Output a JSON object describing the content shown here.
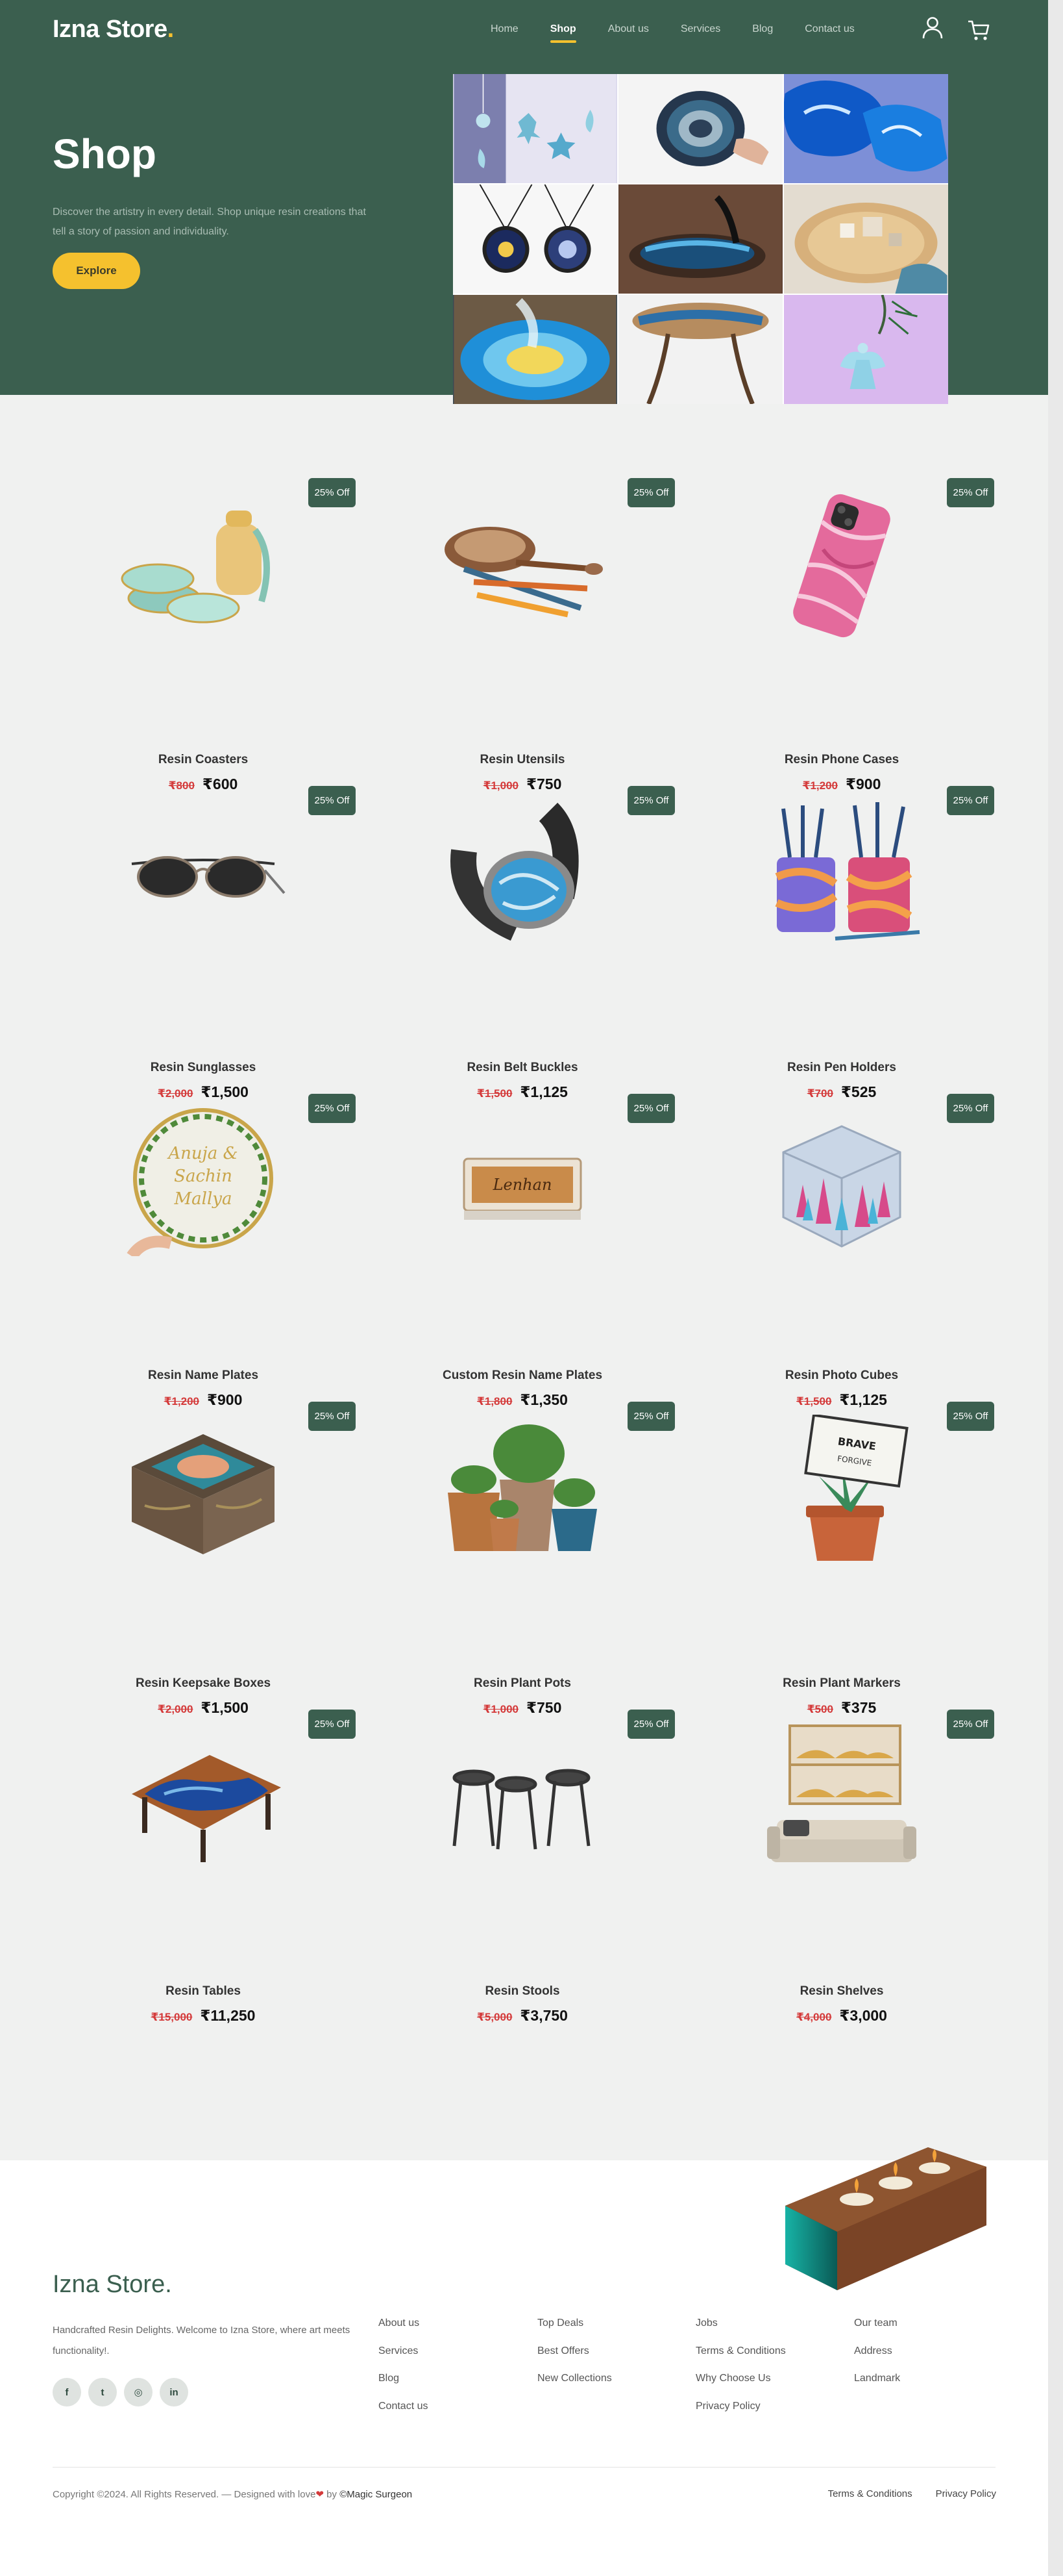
{
  "header": {
    "logo": "Izna Store",
    "logo_dot": ".",
    "nav": [
      {
        "label": "Home",
        "active": false
      },
      {
        "label": "Shop",
        "active": true
      },
      {
        "label": "About us",
        "active": false
      },
      {
        "label": "Services",
        "active": false
      },
      {
        "label": "Blog",
        "active": false
      },
      {
        "label": "Contact us",
        "active": false
      }
    ],
    "icons": [
      "user-icon",
      "cart-icon"
    ]
  },
  "hero": {
    "title": "Shop",
    "description": "Discover the artistry in every detail. Shop unique resin creations that tell a story of passion and individuality.",
    "button": "Explore",
    "tiles": [
      "resin-ornaments",
      "geode-coaster",
      "blue-resin-slices",
      "resin-pendants",
      "river-table-pour",
      "wood-resin-tray",
      "blue-geode-coaster",
      "resin-stool",
      "angel-ornament"
    ]
  },
  "products": [
    {
      "name": "Resin Coasters",
      "old_price": "₹800",
      "price": "₹600",
      "badge": "25% Off"
    },
    {
      "name": "Resin Utensils",
      "old_price": "₹1,000",
      "price": "₹750",
      "badge": "25% Off"
    },
    {
      "name": "Resin Phone Cases",
      "old_price": "₹1,200",
      "price": "₹900",
      "badge": "25% Off"
    },
    {
      "name": "Resin Sunglasses",
      "old_price": "₹2,000",
      "price": "₹1,500",
      "badge": "25% Off"
    },
    {
      "name": "Resin Belt Buckles",
      "old_price": "₹1,500",
      "price": "₹1,125",
      "badge": "25% Off"
    },
    {
      "name": "Resin Pen Holders",
      "old_price": "₹700",
      "price": "₹525",
      "badge": "25% Off"
    },
    {
      "name": "Resin Name Plates",
      "old_price": "₹1,200",
      "price": "₹900",
      "badge": "25% Off"
    },
    {
      "name": "Custom Resin Name Plates",
      "old_price": "₹1,800",
      "price": "₹1,350",
      "badge": "25% Off"
    },
    {
      "name": "Resin Photo Cubes",
      "old_price": "₹1,500",
      "price": "₹1,125",
      "badge": "25% Off"
    },
    {
      "name": "Resin Keepsake Boxes",
      "old_price": "₹2,000",
      "price": "₹1,500",
      "badge": "25% Off"
    },
    {
      "name": "Resin Plant Pots",
      "old_price": "₹1,000",
      "price": "₹750",
      "badge": "25% Off"
    },
    {
      "name": "Resin Plant Markers",
      "old_price": "₹500",
      "price": "₹375",
      "badge": "25% Off"
    },
    {
      "name": "Resin Tables",
      "old_price": "₹15,000",
      "price": "₹11,250",
      "badge": "25% Off"
    },
    {
      "name": "Resin Stools",
      "old_price": "₹5,000",
      "price": "₹3,750",
      "badge": "25% Off"
    },
    {
      "name": "Resin Shelves",
      "old_price": "₹4,000",
      "price": "₹3,000",
      "badge": "25% Off"
    }
  ],
  "footer": {
    "logo": "Izna Store.",
    "about": "Handcrafted Resin Delights. Welcome to Izna Store, where art meets functionality!.",
    "socials": [
      {
        "icon": "facebook-icon",
        "glyph": "f"
      },
      {
        "icon": "twitter-icon",
        "glyph": "t"
      },
      {
        "icon": "instagram-icon",
        "glyph": "◎"
      },
      {
        "icon": "linkedin-icon",
        "glyph": "in"
      }
    ],
    "columns": [
      [
        "About us",
        "Services",
        "Blog",
        "Contact us"
      ],
      [
        "Top Deals",
        "Best Offers",
        "New Collections"
      ],
      [
        "Jobs",
        "Terms & Conditions",
        "Why Choose Us",
        "Privacy Policy"
      ],
      [
        "Our team",
        "Address",
        "Landmark"
      ]
    ],
    "copyright_prefix": "Copyright ©2024. All Rights Reserved. — Designed with love",
    "copyright_by": " by ",
    "copyright_brand": "©Magic Surgeon",
    "bottom_links": [
      "Terms & Conditions",
      "Privacy Policy"
    ]
  },
  "colors": {
    "brand_green": "#3b5f4f",
    "accent_yellow": "#f5c12e",
    "sale_red": "#d43a3a",
    "page_bg": "#f0f1f0"
  }
}
